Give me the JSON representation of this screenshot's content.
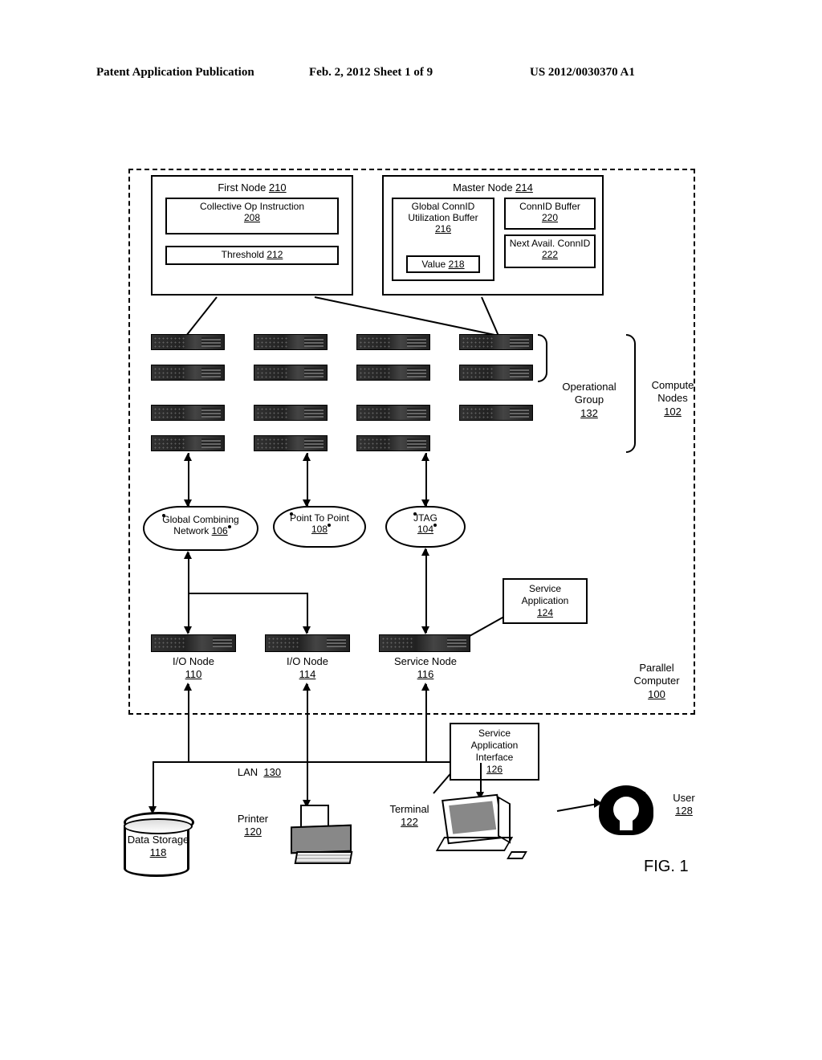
{
  "header": {
    "left": "Patent Application Publication",
    "center": "Feb. 2, 2012  Sheet 1 of 9",
    "right": "US 2012/0030370 A1"
  },
  "first_node": {
    "title": "First Node",
    "title_ref": "210",
    "collective_op": "Collective Op Instruction",
    "collective_op_ref": "208",
    "threshold": "Threshold",
    "threshold_ref": "212"
  },
  "master_node": {
    "title": "Master Node",
    "title_ref": "214",
    "global_buf": "Global ConnID Utilization Buffer",
    "global_buf_ref": "216",
    "value": "Value",
    "value_ref": "218",
    "connid_buf": "ConnID Buffer",
    "connid_buf_ref": "220",
    "next_avail": "Next Avail. ConnID",
    "next_avail_ref": "222"
  },
  "groups": {
    "operational_group": "Operational Group",
    "operational_group_ref": "132",
    "compute_nodes": "Compute Nodes",
    "compute_nodes_ref": "102"
  },
  "clouds": {
    "gcn": "Global Combining Network",
    "gcn_ref": "106",
    "ptp": "Point To Point",
    "ptp_ref": "108",
    "jtag": "JTAG",
    "jtag_ref": "104"
  },
  "mid_nodes": {
    "io1": "I/O Node",
    "io1_ref": "110",
    "io2": "I/O Node",
    "io2_ref": "114",
    "service": "Service Node",
    "service_ref": "116"
  },
  "service_app": {
    "label": "Service Application",
    "ref": "124"
  },
  "parallel_computer": {
    "label": "Parallel Computer",
    "ref": "100"
  },
  "sai": {
    "label": "Service Application Interface",
    "ref": "126"
  },
  "lan": {
    "label": "LAN",
    "ref": "130"
  },
  "bottom": {
    "storage": "Data Storage",
    "storage_ref": "118",
    "printer": "Printer",
    "printer_ref": "120",
    "terminal": "Terminal",
    "terminal_ref": "122",
    "user": "User",
    "user_ref": "128"
  },
  "figure": "FIG. 1"
}
